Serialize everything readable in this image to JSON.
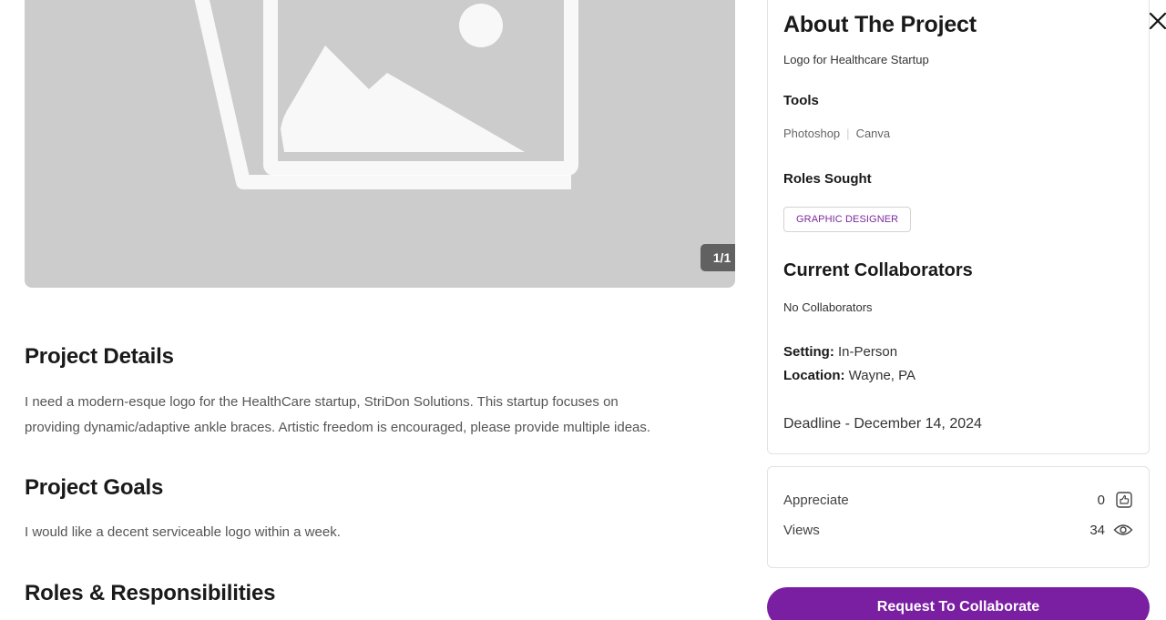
{
  "gallery": {
    "counter": "1/1",
    "icon": "image-placeholder-icon"
  },
  "details": {
    "title": "Project Details",
    "text_line1": "I need a modern-esque logo for the HealthCare startup, StriDon Solutions. This startup focuses on",
    "text_line2": "providing dynamic/adaptive ankle braces. Artistic freedom is encouraged, please provide multiple ideas."
  },
  "goals": {
    "title": "Project Goals",
    "text": "I would like a decent serviceable logo within a week."
  },
  "roles_resp": {
    "title": "Roles & Responsibilities"
  },
  "about": {
    "title": "About The Project",
    "subtitle": "Logo for Healthcare Startup",
    "tools_label": "Tools",
    "tools": [
      "Photoshop",
      "Canva"
    ],
    "tools_separator": "|",
    "roles_label": "Roles Sought",
    "roles": [
      "GRAPHIC DESIGNER"
    ],
    "collaborators_title": "Current Collaborators",
    "collaborators_value": "No Collaborators",
    "setting_label": "Setting:",
    "setting_value": "In-Person",
    "location_label": "Location:",
    "location_value": "Wayne, PA",
    "deadline": "Deadline - December 14, 2024"
  },
  "stats": {
    "appreciate_label": "Appreciate",
    "appreciate_value": "0",
    "appreciate_icon": "appreciate-icon",
    "views_label": "Views",
    "views_value": "34",
    "views_icon": "eye-icon"
  },
  "cta": {
    "label": "Request To Collaborate"
  },
  "close_icon": "close-icon",
  "colors": {
    "accent": "#7a1fa2",
    "placeholder_bg": "#cccccc",
    "counter_bg": "#616161"
  }
}
